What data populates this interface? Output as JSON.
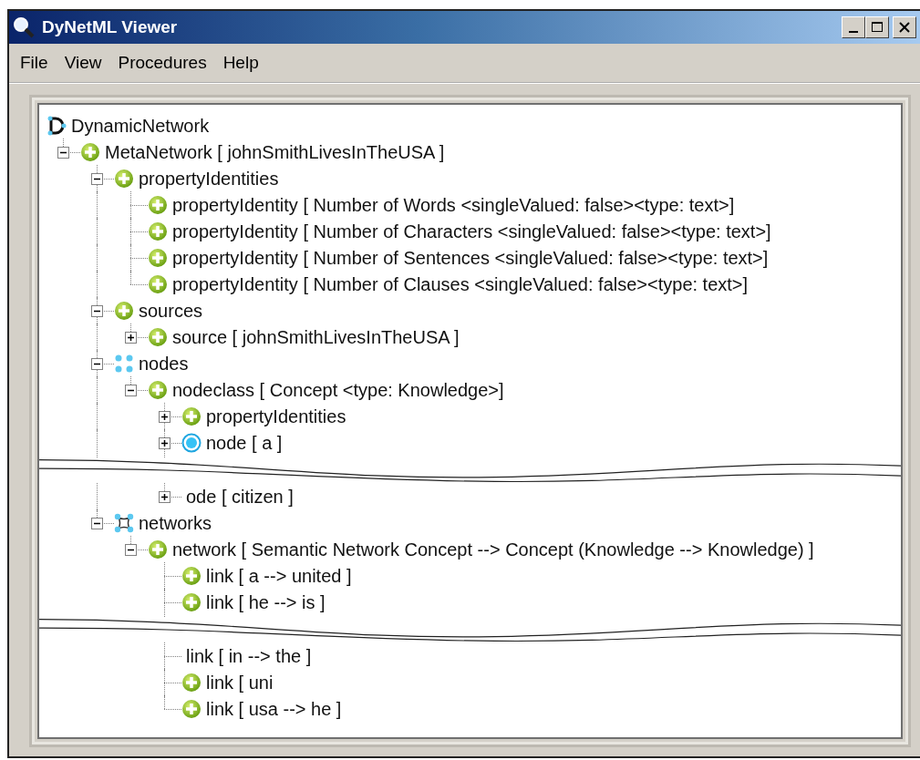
{
  "window": {
    "title": "DyNetML Viewer"
  },
  "menu": [
    "File",
    "View",
    "Procedures",
    "Help"
  ],
  "tree": [
    {
      "text": "DynamicNetwork",
      "kind": "d",
      "children": [
        {
          "text": "MetaNetwork [ johnSmithLivesInTheUSA ]",
          "kind": "plus",
          "expanded": true,
          "children": [
            {
              "text": "propertyIdentities",
              "kind": "plus",
              "expanded": true,
              "children": [
                {
                  "text": "propertyIdentity [ Number of Words <singleValued: false><type: text>]",
                  "kind": "plus"
                },
                {
                  "text": "propertyIdentity [ Number of Characters <singleValued: false><type: text>]",
                  "kind": "plus"
                },
                {
                  "text": "propertyIdentity [ Number of Sentences <singleValued: false><type: text>]",
                  "kind": "plus"
                },
                {
                  "text": "propertyIdentity [ Number of Clauses <singleValued: false><type: text>]",
                  "kind": "plus"
                }
              ]
            },
            {
              "text": "sources",
              "kind": "plus",
              "expanded": true,
              "children": [
                {
                  "text": "source [ johnSmithLivesInTheUSA ]",
                  "kind": "plus",
                  "expanded": false
                }
              ]
            },
            {
              "text": "nodes",
              "kind": "dots",
              "expanded": true,
              "children": [
                {
                  "text": "nodeclass [ Concept <type: Knowledge>]",
                  "kind": "plus",
                  "expanded": true,
                  "children": [
                    {
                      "text": "propertyIdentities",
                      "kind": "plus",
                      "expanded": false
                    },
                    {
                      "text": "node [ a ]",
                      "kind": "circle",
                      "expanded": false
                    },
                    {
                      "text": "ode [ citizen ]",
                      "expanded": false,
                      "break_before": true
                    }
                  ]
                }
              ]
            },
            {
              "text": "networks",
              "kind": "square",
              "expanded": true,
              "children": [
                {
                  "text": "network [ Semantic Network Concept --> Concept (Knowledge --> Knowledge) ]",
                  "kind": "plus",
                  "expanded": true,
                  "children": [
                    {
                      "text": "link [ a --> united ]",
                      "kind": "plus"
                    },
                    {
                      "text": "link [ he --> is ]",
                      "kind": "plus"
                    },
                    {
                      "text": "link [ in --> the ]",
                      "break_before": true
                    },
                    {
                      "text": "link [ uni",
                      "kind": "plus"
                    },
                    {
                      "text": "link [ usa --> he ]",
                      "kind": "plus"
                    }
                  ]
                }
              ]
            }
          ]
        }
      ]
    }
  ]
}
